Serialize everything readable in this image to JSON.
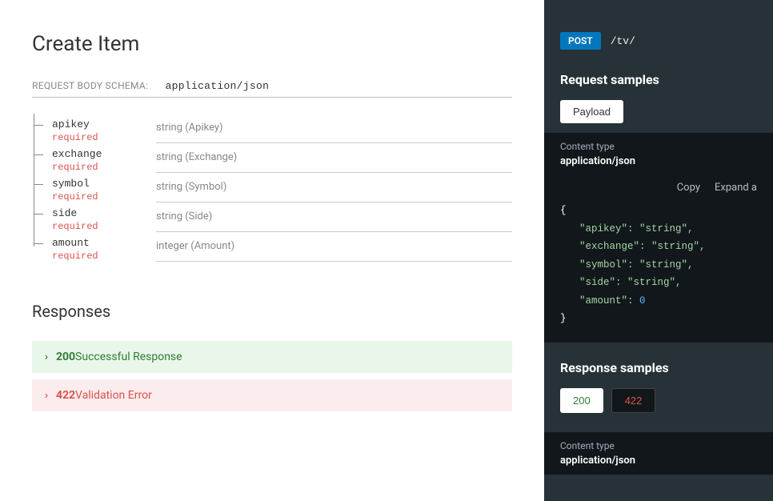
{
  "left": {
    "title": "Create Item",
    "schemaLabel": "REQUEST BODY SCHEMA:",
    "schemaValue": "application/json",
    "props": [
      {
        "name": "apikey",
        "required": "required",
        "desc": "string (Apikey)"
      },
      {
        "name": "exchange",
        "required": "required",
        "desc": "string (Exchange)"
      },
      {
        "name": "symbol",
        "required": "required",
        "desc": "string (Symbol)"
      },
      {
        "name": "side",
        "required": "required",
        "desc": "string (Side)"
      },
      {
        "name": "amount",
        "required": "required",
        "desc": "integer (Amount)"
      }
    ],
    "responsesTitle": "Responses",
    "responses": [
      {
        "code": "200",
        "text": " Successful Response",
        "type": "success"
      },
      {
        "code": "422",
        "text": " Validation Error",
        "type": "error"
      }
    ]
  },
  "right": {
    "method": "POST",
    "path": "/tv/",
    "requestSamplesTitle": "Request samples",
    "payloadTab": "Payload",
    "contentTypeLabel": "Content type",
    "contentTypeValue": "application/json",
    "copyLabel": "Copy",
    "expandLabel": "Expand a",
    "sampleFields": [
      {
        "key": "apikey",
        "val": "string",
        "type": "str",
        "comma": ","
      },
      {
        "key": "exchange",
        "val": "string",
        "type": "str",
        "comma": ","
      },
      {
        "key": "symbol",
        "val": "string",
        "type": "str",
        "comma": ","
      },
      {
        "key": "side",
        "val": "string",
        "type": "str",
        "comma": ","
      },
      {
        "key": "amount",
        "val": "0",
        "type": "num",
        "comma": ""
      }
    ],
    "responseSamplesTitle": "Response samples",
    "responseTabs": [
      {
        "label": "200",
        "style": "green",
        "active": true
      },
      {
        "label": "422",
        "style": "red",
        "active": false
      }
    ]
  }
}
